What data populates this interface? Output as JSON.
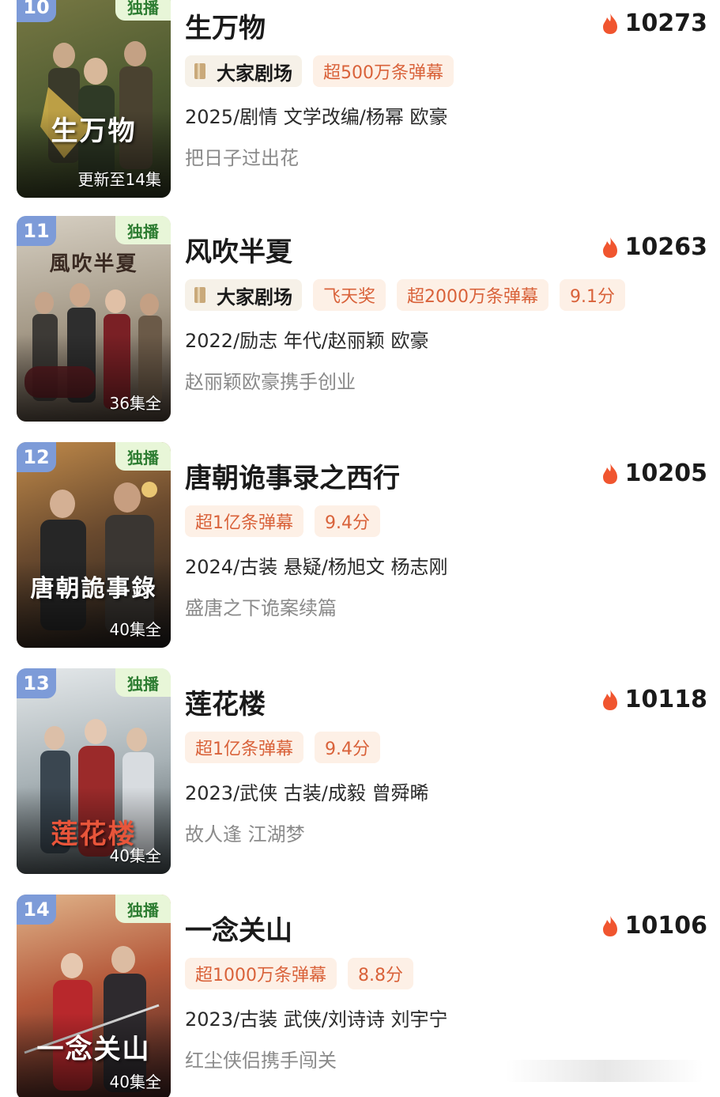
{
  "items": [
    {
      "rank": "10",
      "exclusive": "独播",
      "poster_title": "生万物",
      "episodes": "更新至14集",
      "title": "生万物",
      "heat": "10273",
      "theater": "大家剧场",
      "tags": [
        "超500万条弹幕"
      ],
      "meta": "2025/剧情 文学改编/杨幂 欧豪",
      "desc": "把日子过出花",
      "poster_colors": [
        "#6b6a3a",
        "#3f4a2a"
      ]
    },
    {
      "rank": "11",
      "exclusive": "独播",
      "poster_title": "風吹半夏",
      "episodes": "36集全",
      "title": "风吹半夏",
      "heat": "10263",
      "theater": "大家剧场",
      "tags": [
        "飞天奖",
        "超2000万条弹幕",
        "9.1分"
      ],
      "meta": "2022/励志 年代/赵丽颖 欧豪",
      "desc": "赵丽颖欧豪携手创业",
      "poster_colors": [
        "#c9c2b4",
        "#6b5a4a"
      ]
    },
    {
      "rank": "12",
      "exclusive": "独播",
      "poster_title": "唐朝詭事錄",
      "episodes": "40集全",
      "title": "唐朝诡事录之西行",
      "heat": "10205",
      "theater": "",
      "tags": [
        "超1亿条弹幕",
        "9.4分"
      ],
      "meta": "2024/古装 悬疑/杨旭文 杨志刚",
      "desc": "盛唐之下诡案续篇",
      "poster_colors": [
        "#a8733e",
        "#2c2a28"
      ]
    },
    {
      "rank": "13",
      "exclusive": "独播",
      "poster_title": "莲花楼",
      "episodes": "40集全",
      "title": "莲花楼",
      "heat": "10118",
      "theater": "",
      "tags": [
        "超1亿条弹幕",
        "9.4分"
      ],
      "meta": "2023/武侠 古装/成毅 曾舜晞",
      "desc": "故人逢 江湖梦",
      "poster_colors": [
        "#d8dde0",
        "#7c8a90"
      ]
    },
    {
      "rank": "14",
      "exclusive": "独播",
      "poster_title": "一念关山",
      "episodes": "40集全",
      "title": "一念关山",
      "heat": "10106",
      "theater": "",
      "tags": [
        "超1000万条弹幕",
        "8.8分"
      ],
      "meta": "2023/古装 武侠/刘诗诗 刘宇宁",
      "desc": "红尘侠侣携手闯关",
      "poster_colors": [
        "#c25a3a",
        "#3a2a2a"
      ]
    }
  ]
}
